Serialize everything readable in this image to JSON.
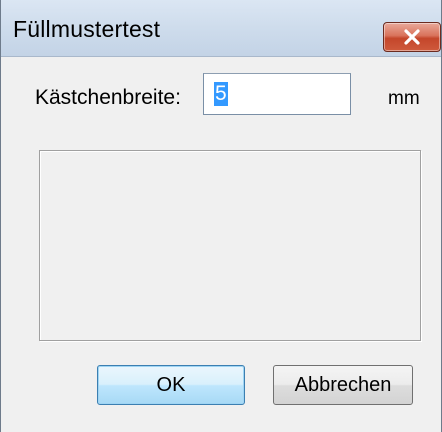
{
  "window": {
    "title": "Füllmustertest",
    "close_icon": "close-icon",
    "close_color": "#c4462b"
  },
  "form": {
    "width_label": "Kästchenbreite:",
    "width_value": "5",
    "unit": "mm"
  },
  "buttons": {
    "ok_label": "OK",
    "cancel_label": "Abbrechen"
  },
  "colors": {
    "selection": "#3399ff",
    "default_button_border": "#3c7fb1"
  }
}
